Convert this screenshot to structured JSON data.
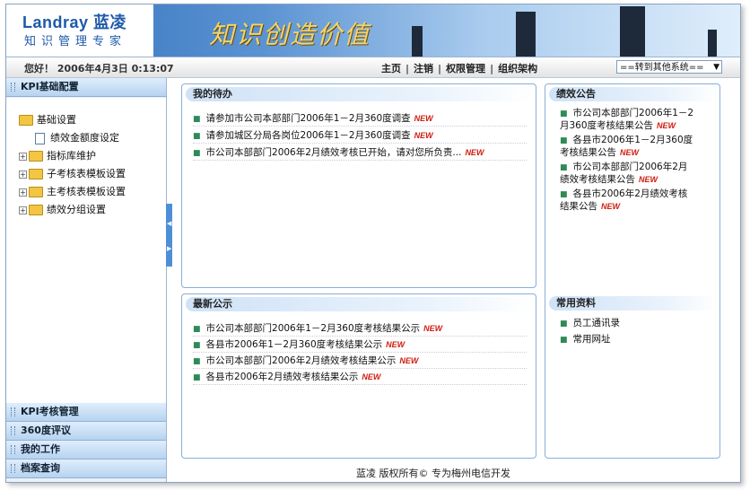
{
  "header": {
    "logo_en": "Landray",
    "logo_cn": "蓝凌",
    "logo_sub": "知识管理专家",
    "slogan": "知识创造价值"
  },
  "topbar": {
    "greeting": "您好！ 2006年4月3日 0:13:07",
    "nav": [
      "主页",
      "注销",
      "权限管理",
      "组织架构"
    ],
    "system_select": "==转到其他系统=="
  },
  "sidebar": {
    "head": "KPI基础配置",
    "tree": {
      "root": "基础设置",
      "items": [
        "绩效金额度设定",
        "指标库维护",
        "子考核表模板设置",
        "主考核表模板设置",
        "绩效分组设置"
      ]
    },
    "sections": [
      "KPI考核管理",
      "360度评议",
      "我的工作",
      "档案查询"
    ]
  },
  "todo": {
    "title": "我的待办",
    "items": [
      "请参加市公司本部部门2006年1－2月360度调查",
      "请参加城区分局各岗位2006年1－2月360度调查",
      "市公司本部部门2006年2月绩效考核已开始，请对您所负责..."
    ]
  },
  "latest": {
    "title": "最新公示",
    "items": [
      "市公司本部部门2006年1－2月360度考核结果公示",
      "各县市2006年1－2月360度考核结果公示",
      "市公司本部部门2006年2月绩效考核结果公示",
      "各县市2006年2月绩效考核结果公示"
    ]
  },
  "notice": {
    "title": "绩效公告",
    "items": [
      {
        "l1": "市公司本部部门2006年1－2",
        "l2": "月360度考核结果公告"
      },
      {
        "l1": "各县市2006年1－2月360度",
        "l2": "考核结果公告"
      },
      {
        "l1": "市公司本部部门2006年2月",
        "l2": "绩效考核结果公告"
      },
      {
        "l1": "各县市2006年2月绩效考核",
        "l2": "结果公告"
      }
    ]
  },
  "resources": {
    "title": "常用资料",
    "items": [
      "员工通讯录",
      "常用网址"
    ]
  },
  "new_badge": "NEW",
  "footer": "蓝凌 版权所有©   专为梅州电信开发"
}
